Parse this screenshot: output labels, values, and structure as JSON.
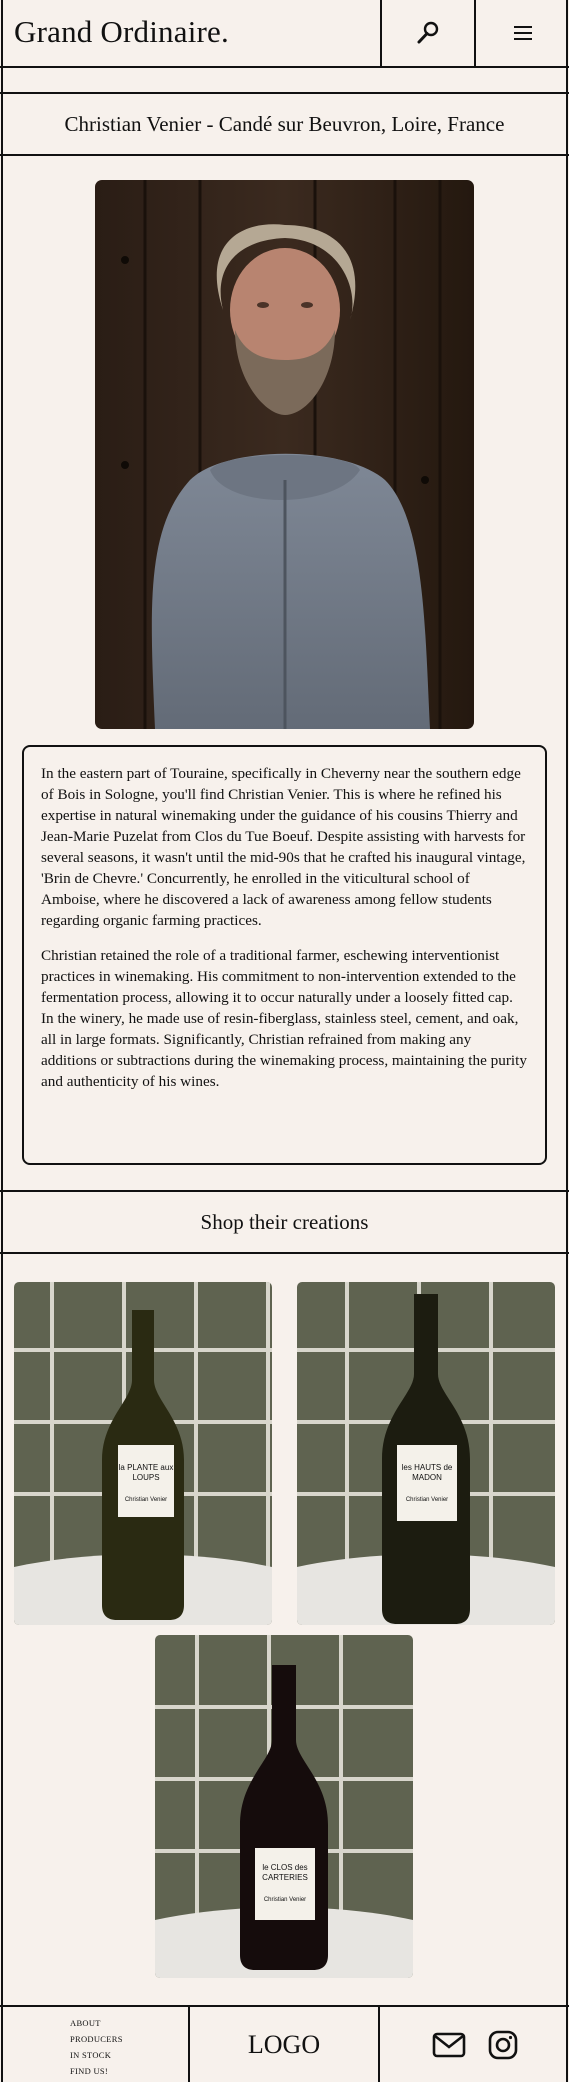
{
  "header": {
    "brand": "Grand Ordinaire.",
    "search_icon": "search-icon",
    "menu_icon": "hamburger-menu-icon"
  },
  "producer": {
    "title": "Christian Venier - Candé sur Beuvron, Loire, France",
    "bio": [
      "In the eastern part of Touraine, specifically in Cheverny near the southern edge of Bois in Sologne, you'll find Christian Venier. This is where he refined his expertise in natural winemaking under the guidance of his cousins Thierry and Jean-Marie Puzelat from Clos du Tue Boeuf. Despite assisting with harvests for several seasons, it wasn't until the mid-90s that he crafted his inaugural vintage, 'Brin de Chevre.' Concurrently, he enrolled in the viticultural school of Amboise, where he discovered a lack of awareness among fellow students regarding organic farming practices.",
      "Christian retained the role of a traditional farmer, eschewing interventionist practices in winemaking. His commitment to non-intervention extended to the fermentation process, allowing it to occur naturally under a loosely fitted cap. In the winery, he made use of resin-fiberglass, stainless steel, cement, and oak, all in large formats. Significantly, Christian refrained from making any additions or subtractions during the winemaking process, maintaining the purity and authenticity of his wines."
    ]
  },
  "shop": {
    "heading": "Shop their creations",
    "products": [
      {
        "label_lines": [
          "la PLANTE aux",
          "LOUPS"
        ],
        "producer": "Christian Venier",
        "wine_color": "#2a2a12"
      },
      {
        "label_lines": [
          "les HAUTS de",
          "MADON"
        ],
        "producer": "Christian Venier",
        "wine_color": "#1c1c10"
      },
      {
        "label_lines": [
          "le CLOS des",
          "CARTERIES"
        ],
        "producer": "Christian Venier",
        "wine_color": "#150c0c"
      }
    ]
  },
  "footer": {
    "links": [
      "ABOUT",
      "PRODUCERS",
      "IN STOCK",
      "FIND US!"
    ],
    "logo": "LOGO",
    "email_icon": "envelope-icon",
    "instagram_icon": "instagram-icon"
  }
}
